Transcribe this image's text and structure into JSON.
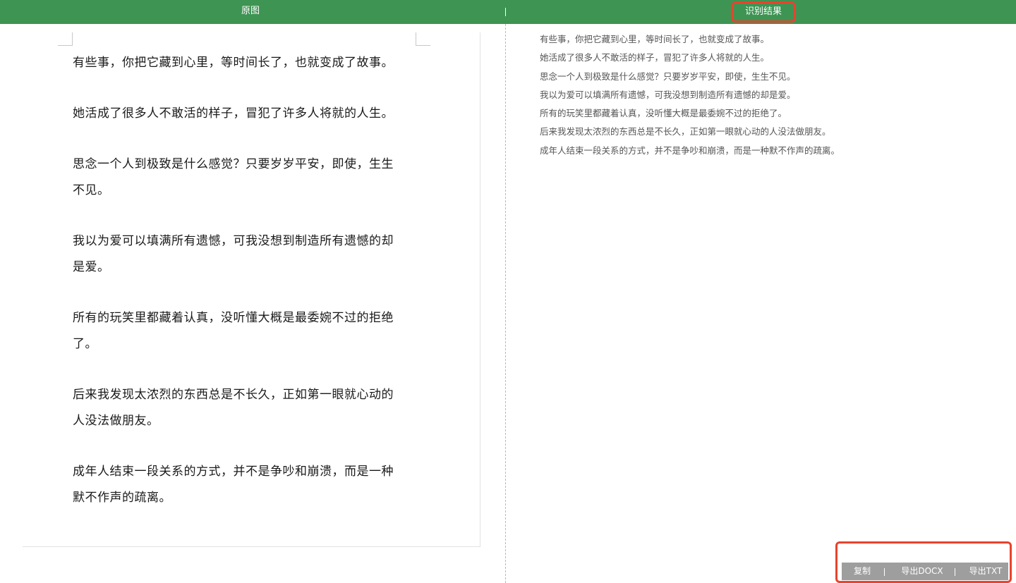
{
  "header": {
    "tab_original": "原图",
    "tab_result": "识别结果",
    "accent_color": "#3e9453",
    "highlight_color": "#e8432e"
  },
  "original_document": {
    "paragraphs": [
      [
        "有些事，你把它藏到心里，等时间长了，也就变成了故事。"
      ],
      [
        "她活成了很多人不敢活的样子，冒犯了许多人将就的人生。"
      ],
      [
        "思念一个人到极致是什么感觉？只要岁岁平安，即使，生生",
        "不见。"
      ],
      [
        "我以为爱可以填满所有遗憾，可我没想到制造所有遗憾的却",
        "是爱。"
      ],
      [
        "所有的玩笑里都藏着认真，没听懂大概是最委婉不过的拒绝",
        "了。"
      ],
      [
        "后来我发现太浓烈的东西总是不长久，正如第一眼就心动的",
        "人没法做朋友。"
      ],
      [
        "成年人结束一段关系的方式，并不是争吵和崩溃，而是一种",
        "默不作声的疏离。"
      ]
    ]
  },
  "recognition_result": {
    "lines": [
      "有些事，你把它藏到心里，等时间长了，也就变成了故事。",
      "她活成了很多人不敢活的样子，冒犯了许多人将就的人生。",
      "思念一个人到极致是什么感觉？只要岁岁平安，即使，生生不见。",
      "我以为爱可以填满所有遗憾，可我没想到制造所有遗憾的却是爱。",
      "所有的玩笑里都藏着认真，没听懂大概是最委婉不过的拒绝了。",
      "后来我发现太浓烈的东西总是不长久，正如第一眼就心动的人没法做朋友。",
      "成年人结束一段关系的方式，并不是争吵和崩溃，而是一种默不作声的疏离。"
    ]
  },
  "actions": {
    "copy_label": "复制",
    "export_docx_label": "导出DOCX",
    "export_txt_label": "导出TXT",
    "separator": "|"
  }
}
